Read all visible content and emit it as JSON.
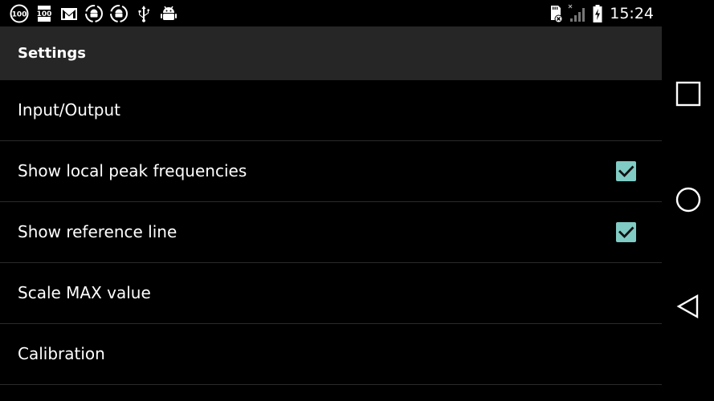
{
  "status_bar": {
    "time": "15:24",
    "left_icons": [
      "battery-100-icon",
      "battery-100-alt-icon",
      "gmail-icon",
      "android-sync-icon",
      "android-sync-alt-icon",
      "usb-icon",
      "android-debug-icon"
    ],
    "right_icons": [
      "sd-card-error-icon",
      "no-signal-icon",
      "battery-charging-icon"
    ],
    "badge_100": "100"
  },
  "action_bar": {
    "title": "Settings"
  },
  "preferences": [
    {
      "label": "Input/Output",
      "checkbox": false
    },
    {
      "label": "Show local peak frequencies",
      "checkbox": true,
      "checked": true
    },
    {
      "label": "Show reference line",
      "checkbox": true,
      "checked": true
    },
    {
      "label": "Scale MAX value",
      "checkbox": false
    },
    {
      "label": "Calibration",
      "checkbox": false
    }
  ],
  "nav_bar": {
    "buttons": [
      "recents-icon",
      "home-icon",
      "back-icon"
    ]
  },
  "colors": {
    "checkbox_accent": "#80cbc4",
    "action_bar_bg": "#262626",
    "background": "#000000"
  }
}
